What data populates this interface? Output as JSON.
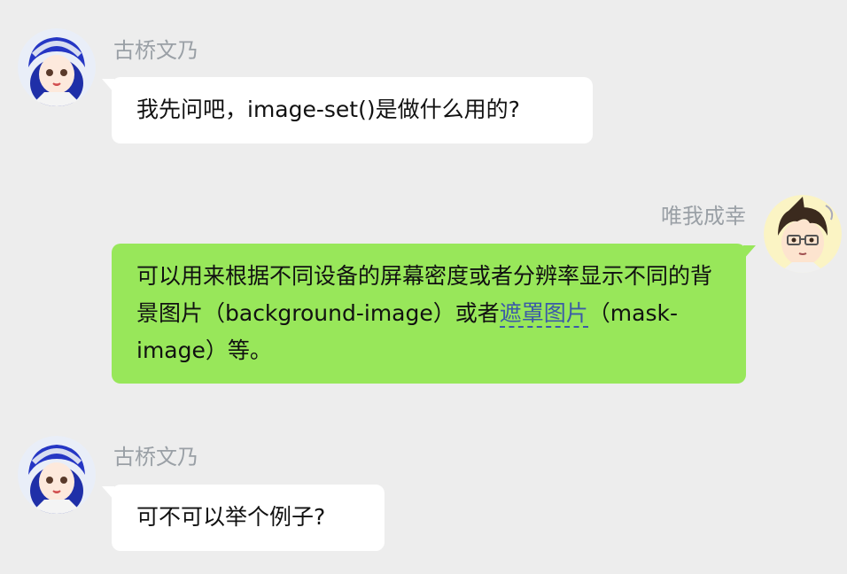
{
  "messages": [
    {
      "side": "left",
      "sender": "古桥文乃",
      "text": "我先问吧，image-set()是做什么用的?"
    },
    {
      "side": "right",
      "sender": "唯我成幸",
      "text_before": "可以用来根据不同设备的屏幕密度或者分辨率显示不同的背景图片（background-image）或者",
      "link_text": "遮罩图片",
      "text_after": "（mask-image）等。"
    },
    {
      "side": "left",
      "sender": "古桥文乃",
      "text": "可不可以举个例子?"
    }
  ],
  "colors": {
    "background": "#ededed",
    "left_bubble": "#ffffff",
    "right_bubble": "#98e75a",
    "name_text": "#9aa0a6",
    "link": "#3b5aa8"
  },
  "icons": {
    "left_avatar": "anime-girl-avatar",
    "right_avatar": "anime-boy-avatar"
  }
}
